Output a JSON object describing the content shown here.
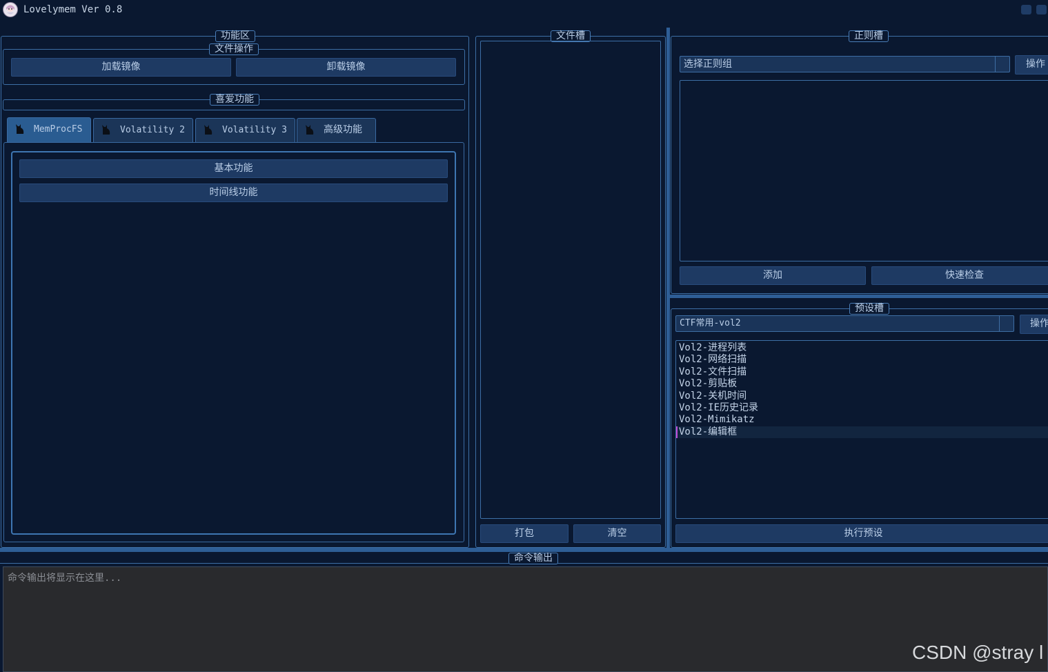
{
  "window": {
    "title": "Lovelymem Ver 0.8",
    "controls": [
      "minimize-button",
      "maximize-button"
    ]
  },
  "function_area": {
    "title": "功能区",
    "file_ops": {
      "title": "文件操作",
      "load_label": "加载镜像",
      "unload_label": "卸载镜像"
    },
    "favorites": {
      "title": "喜爱功能"
    },
    "tabs": [
      {
        "label": "MemProcFS",
        "icon": "cat-icon",
        "active": true
      },
      {
        "label": "Volatility 2",
        "icon": "cat-icon",
        "active": false
      },
      {
        "label": "Volatility 3",
        "icon": "cat-icon",
        "active": false
      },
      {
        "label": "高级功能",
        "icon": "cat-icon",
        "active": false
      }
    ],
    "buttons": [
      {
        "label": "基本功能"
      },
      {
        "label": "时间线功能"
      }
    ]
  },
  "file_slot": {
    "title": "文件槽",
    "pack_label": "打包",
    "clear_label": "清空"
  },
  "regex_slot": {
    "title": "正则槽",
    "selected": "选择正则组",
    "action_label": "操作",
    "add_label": "添加",
    "quick_check_label": "快速检查"
  },
  "preset_slot": {
    "title": "预设槽",
    "selected": "CTF常用-vol2",
    "action_label": "操作",
    "items": [
      "Vol2-进程列表",
      "Vol2-网络扫描",
      "Vol2-文件扫描",
      "Vol2-剪贴板",
      "Vol2-关机时间",
      "Vol2-IE历史记录",
      "Vol2-Mimikatz",
      "Vol2-编辑框"
    ],
    "run_label": "执行预设"
  },
  "command_output": {
    "title": "命令输出",
    "placeholder": "命令输出将显示在这里..."
  },
  "watermark": "CSDN @stray l",
  "colors": {
    "background": "#0a1830",
    "border": "#3d6fa6",
    "button": "#1e3a63",
    "active_tab": "#2a5c91",
    "output_bg": "#292a2d"
  }
}
